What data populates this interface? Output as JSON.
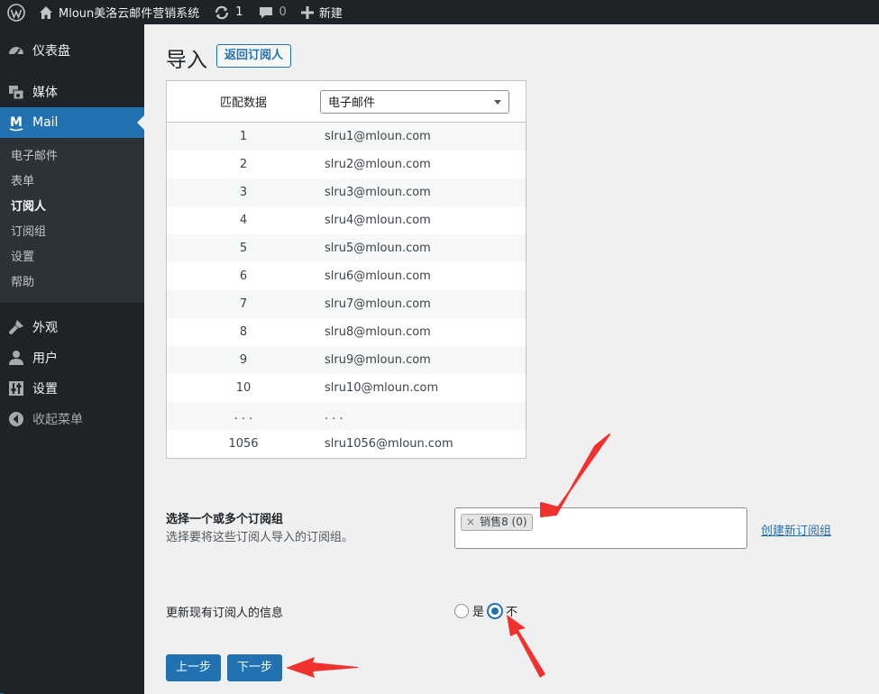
{
  "adminbar": {
    "site_name": "Mloun美洛云邮件营销系统",
    "updates_count": "1",
    "comments_count": "0",
    "new_label": "新建"
  },
  "sidebar": {
    "dashboard": "仪表盘",
    "media": "媒体",
    "mail": "Mail",
    "mail_submenu": [
      "电子邮件",
      "表单",
      "订阅人",
      "订阅组",
      "设置",
      "帮助"
    ],
    "appearance": "外观",
    "users": "用户",
    "settings": "设置",
    "collapse": "收起菜单"
  },
  "page": {
    "title": "导入",
    "back_button": "返回订阅人"
  },
  "import_table": {
    "header_label": "匹配数据",
    "match_select_value": "电子邮件",
    "rows": [
      {
        "n": "1",
        "email": "slru1@mloun.com"
      },
      {
        "n": "2",
        "email": "slru2@mloun.com"
      },
      {
        "n": "3",
        "email": "slru3@mloun.com"
      },
      {
        "n": "4",
        "email": "slru4@mloun.com"
      },
      {
        "n": "5",
        "email": "slru5@mloun.com"
      },
      {
        "n": "6",
        "email": "slru6@mloun.com"
      },
      {
        "n": "7",
        "email": "slru7@mloun.com"
      },
      {
        "n": "8",
        "email": "slru8@mloun.com"
      },
      {
        "n": "9",
        "email": "slru9@mloun.com"
      },
      {
        "n": "10",
        "email": "slru10@mloun.com"
      },
      {
        "n": ". . .",
        "email": ". . ."
      },
      {
        "n": "1056",
        "email": "slru1056@mloun.com"
      }
    ]
  },
  "lists_section": {
    "title": "选择一个或多个订阅组",
    "description": "选择要将这些订阅人导入的订阅组。",
    "selected_tag": "销售8 (0)",
    "tag_remove": "×",
    "create_link": "创建新订阅组"
  },
  "update_section": {
    "label": "更新现有订阅人的信息",
    "option_yes": "是",
    "option_no": "不",
    "selected": "不"
  },
  "buttons": {
    "prev": "上一步",
    "next": "下一步"
  },
  "colors": {
    "accent": "#2271b1",
    "admin_dark": "#1d2327",
    "arrow_red": "#f0312d"
  }
}
